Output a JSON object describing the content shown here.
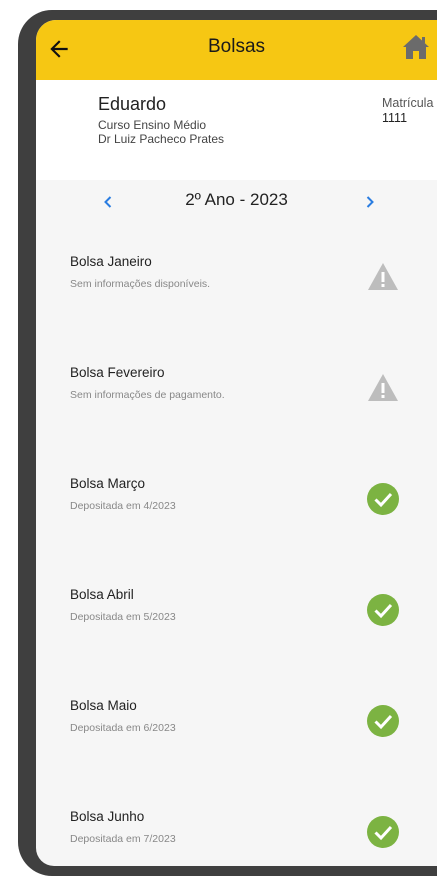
{
  "appbar": {
    "title": "Bolsas",
    "back_icon": "arrow-left-icon",
    "home_icon": "home-icon",
    "color": "#f6c713"
  },
  "student": {
    "name": "Eduardo",
    "course": "Curso Ensino Médio",
    "school": "Dr Luiz Pacheco Prates",
    "matricula_label": "Matrícula",
    "matricula_value": "1111"
  },
  "year_nav": {
    "label": "2º Ano - 2023",
    "prev_icon": "chevron-left-icon",
    "next_icon": "chevron-right-icon",
    "accent": "#2a7de1"
  },
  "items": [
    {
      "title": "Bolsa Janeiro",
      "subtitle": "Sem informações disponíveis.",
      "status": "warning"
    },
    {
      "title": "Bolsa Fevereiro",
      "subtitle": "Sem informações de pagamento.",
      "status": "warning"
    },
    {
      "title": "Bolsa Março",
      "subtitle": "Depositada em 4/2023",
      "status": "ok"
    },
    {
      "title": "Bolsa Abril",
      "subtitle": "Depositada em 5/2023",
      "status": "ok"
    },
    {
      "title": "Bolsa Maio",
      "subtitle": "Depositada em 6/2023",
      "status": "ok"
    },
    {
      "title": "Bolsa Junho",
      "subtitle": "Depositada em 7/2023",
      "status": "ok"
    }
  ],
  "status_colors": {
    "ok": "#7cb342",
    "warning": "#bdbdbd"
  }
}
